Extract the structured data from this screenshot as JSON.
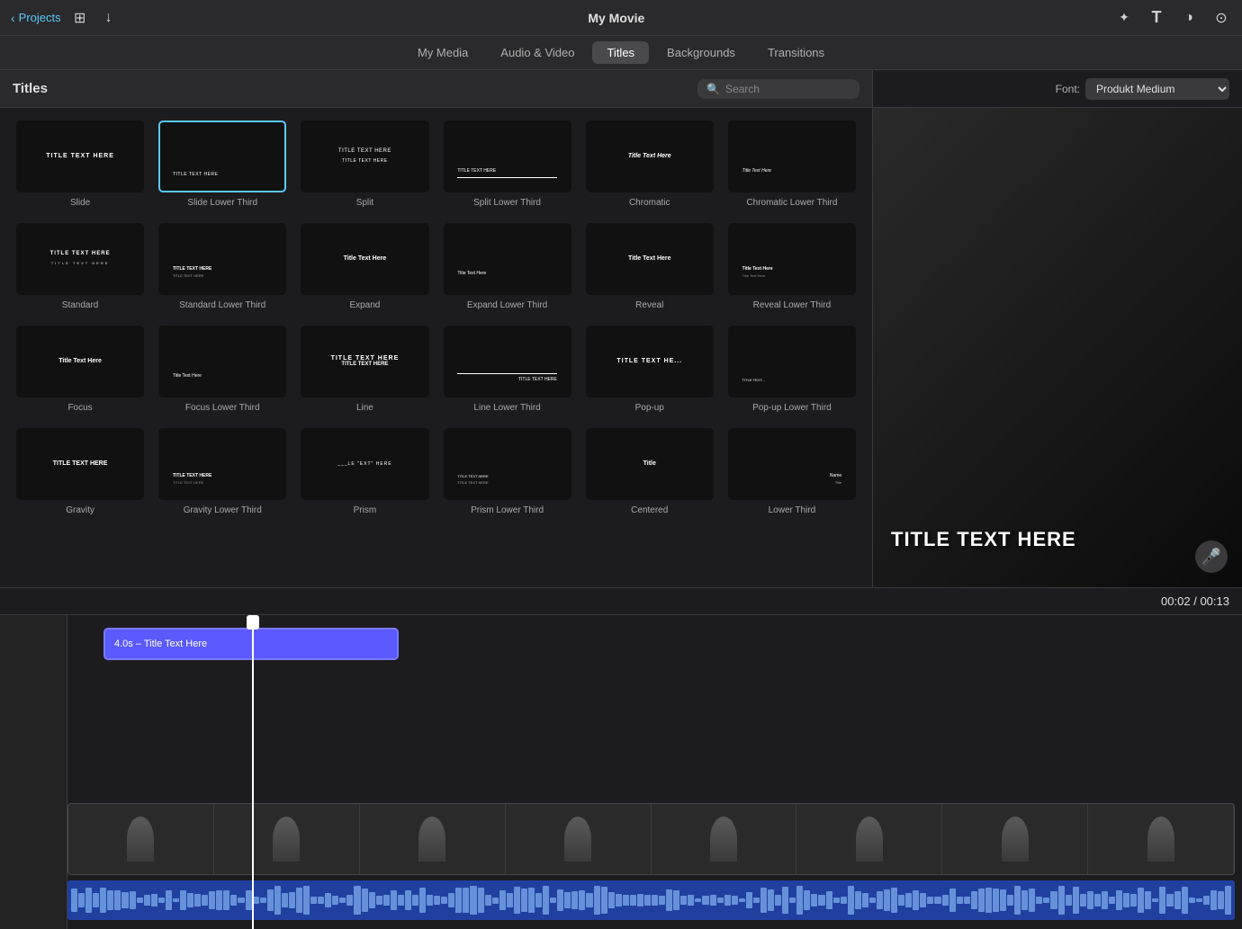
{
  "app": {
    "title": "My Movie",
    "projects_label": "Projects"
  },
  "top_bar": {
    "icons": [
      "grid-icon",
      "sort-icon",
      "download-icon"
    ]
  },
  "right_toolbar": {
    "font_label": "Font:",
    "font_value": "Produkt Medium",
    "icons": [
      "text-icon",
      "color-icon",
      "settings-icon"
    ]
  },
  "nav_tabs": [
    {
      "id": "my-media",
      "label": "My Media"
    },
    {
      "id": "audio-video",
      "label": "Audio & Video"
    },
    {
      "id": "titles",
      "label": "Titles",
      "active": true
    },
    {
      "id": "backgrounds",
      "label": "Backgrounds"
    },
    {
      "id": "transitions",
      "label": "Transitions"
    }
  ],
  "left_panel": {
    "title": "Titles",
    "search_placeholder": "Search"
  },
  "titles": [
    {
      "id": "slide",
      "label": "Slide",
      "style": "bold-top"
    },
    {
      "id": "slide-lower-third",
      "label": "Slide Lower Third",
      "style": "lower-third-light",
      "selected": true
    },
    {
      "id": "split",
      "label": "Split",
      "style": "bold-top-small"
    },
    {
      "id": "split-lower-third",
      "label": "Split Lower Third",
      "style": "lower-third-double"
    },
    {
      "id": "chromatic",
      "label": "Chromatic",
      "style": "chromatic"
    },
    {
      "id": "chromatic-lower-third",
      "label": "Chromatic Lower Third",
      "style": "lower-third-chromatic"
    },
    {
      "id": "standard",
      "label": "Standard",
      "style": "standard"
    },
    {
      "id": "standard-lower-third",
      "label": "Standard Lower Third",
      "style": "lower-third-standard"
    },
    {
      "id": "expand",
      "label": "Expand",
      "style": "expand"
    },
    {
      "id": "expand-lower-third",
      "label": "Expand Lower Third",
      "style": "lower-third-expand"
    },
    {
      "id": "reveal",
      "label": "Reveal",
      "style": "reveal"
    },
    {
      "id": "reveal-lower-third",
      "label": "Reveal Lower Third",
      "style": "lower-third-reveal"
    },
    {
      "id": "focus",
      "label": "Focus",
      "style": "focus"
    },
    {
      "id": "focus-lower-third",
      "label": "Focus Lower Third",
      "style": "lower-third-focus"
    },
    {
      "id": "line",
      "label": "Line",
      "style": "line"
    },
    {
      "id": "line-lower-third",
      "label": "Line Lower Third",
      "style": "lower-third-line"
    },
    {
      "id": "pop-up",
      "label": "Pop-up",
      "style": "popup"
    },
    {
      "id": "pop-up-lower-third",
      "label": "Pop-up Lower Third",
      "style": "lower-third-popup"
    },
    {
      "id": "gravity",
      "label": "Gravity",
      "style": "gravity"
    },
    {
      "id": "gravity-lower-third",
      "label": "Gravity Lower Third",
      "style": "lower-third-gravity"
    },
    {
      "id": "prism",
      "label": "Prism",
      "style": "prism"
    },
    {
      "id": "prism-lower-third",
      "label": "Prism Lower Third",
      "style": "lower-third-prism"
    },
    {
      "id": "centered",
      "label": "Centered",
      "style": "centered"
    },
    {
      "id": "lower-third",
      "label": "Lower Third",
      "style": "lower-third-basic"
    }
  ],
  "preview": {
    "title_overlay": "TITLE TEXT HERE"
  },
  "timeline": {
    "current_time": "00:02",
    "total_time": "00:13",
    "time_separator": "/"
  },
  "title_clip": {
    "label": "4.0s – Title Text Here"
  }
}
